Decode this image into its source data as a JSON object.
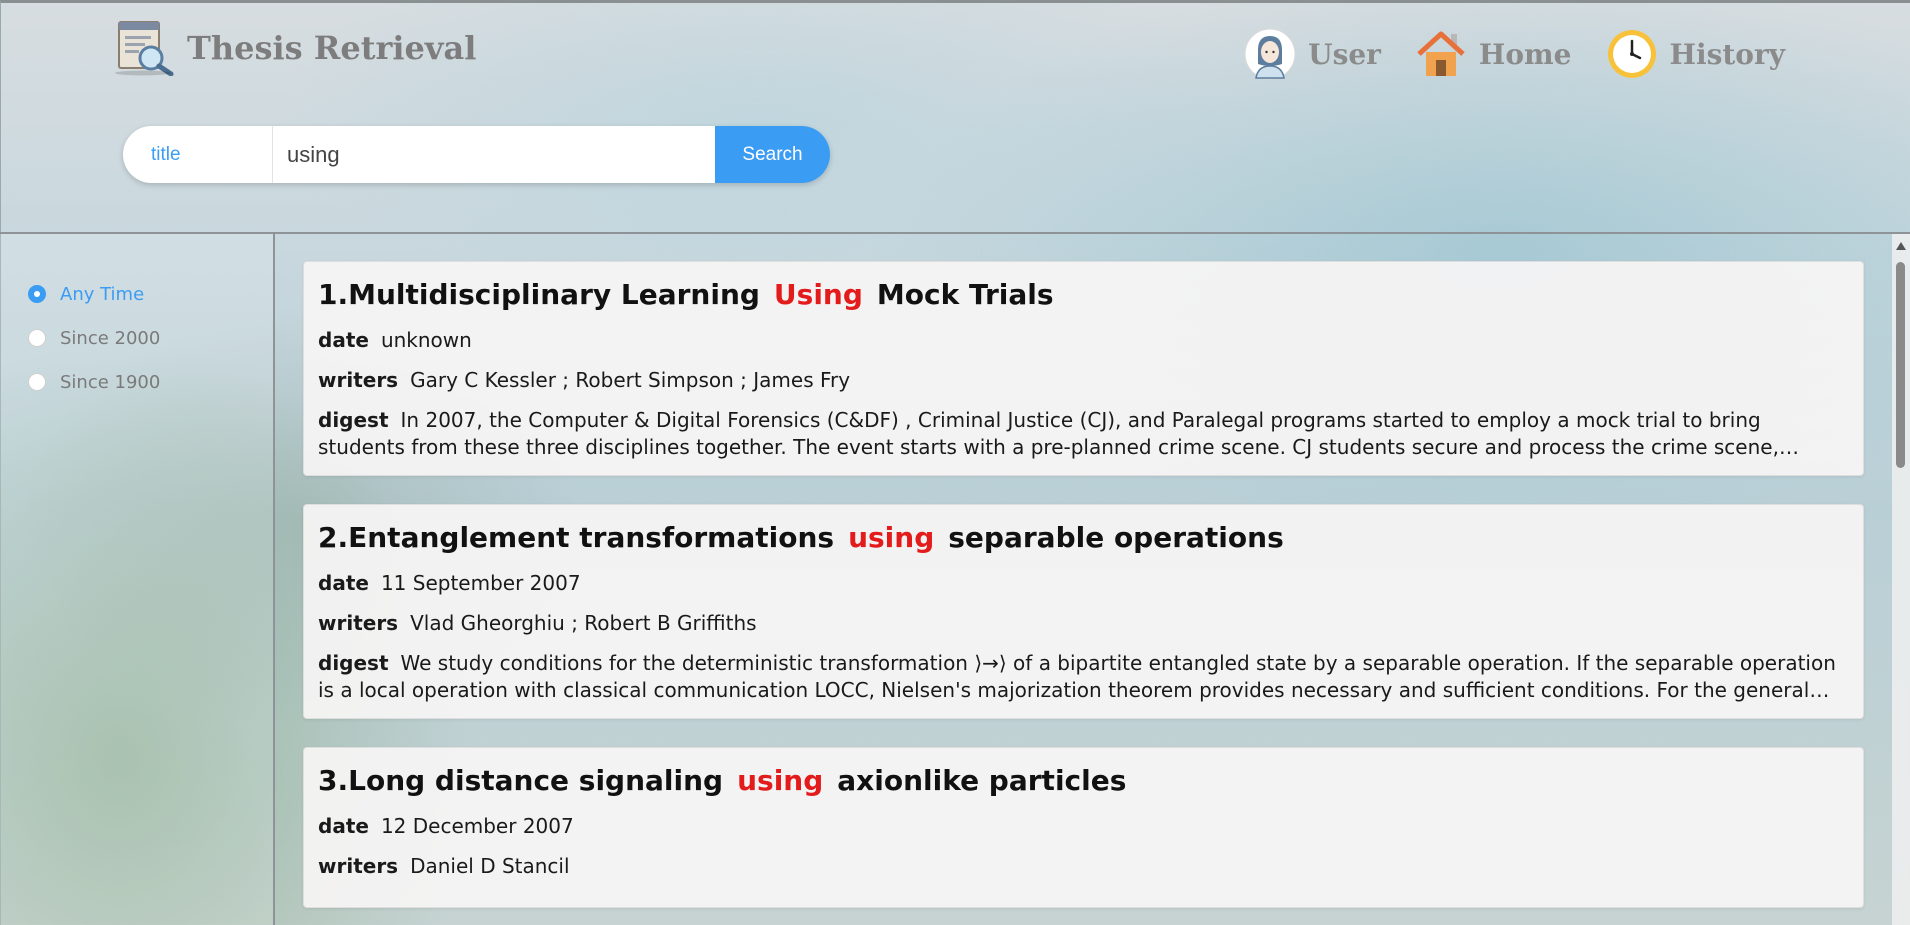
{
  "header": {
    "title": "Thesis Retrieval",
    "nav": [
      {
        "label": "User",
        "icon": "user-avatar-icon"
      },
      {
        "label": "Home",
        "icon": "home-icon"
      },
      {
        "label": "History",
        "icon": "clock-icon"
      }
    ]
  },
  "search": {
    "field": "title",
    "query": "using",
    "button_label": "Search"
  },
  "filters": {
    "options": [
      {
        "label": "Any Time",
        "selected": true
      },
      {
        "label": "Since 2000",
        "selected": false
      },
      {
        "label": "Since 1900",
        "selected": false
      }
    ]
  },
  "labels": {
    "date": "date",
    "writers": "writers",
    "digest": "digest"
  },
  "results": [
    {
      "index": "1.",
      "title_before": "Multidisciplinary Learning",
      "title_highlight": "Using",
      "title_after": "Mock Trials",
      "date": "unknown",
      "writers": "Gary C Kessler ; Robert Simpson ; James Fry",
      "digest": "In 2007, the Computer & Digital Forensics (C&DF) , Criminal Justice (CJ), and Paralegal programs started to employ a mock trial to bring students from these three disciplines together. The event starts with a pre-planned crime scene. CJ students secure and process the crime scene, interview..."
    },
    {
      "index": "2.",
      "title_before": "Entanglement transformations",
      "title_highlight": "using",
      "title_after": "separable operations",
      "date": "11 September 2007",
      "writers": "Vlad Gheorghiu ; Robert B Griffiths",
      "digest": "We study conditions for the deterministic transformation ⟩→⟩ of a bipartite entangled state by a separable operation. If the separable operation is a local operation with classical communication LOCC, Nielsen's majorization theorem provides necessary and sufficient conditions. For the general case, we..."
    },
    {
      "index": "3.",
      "title_before": "Long distance signaling",
      "title_highlight": "using",
      "title_after": "axionlike particles",
      "date": "12 December 2007",
      "writers": "Daniel D Stancil",
      "digest": ""
    }
  ],
  "colors": {
    "accent": "#3b9cf3",
    "highlight": "#e31b1b"
  }
}
